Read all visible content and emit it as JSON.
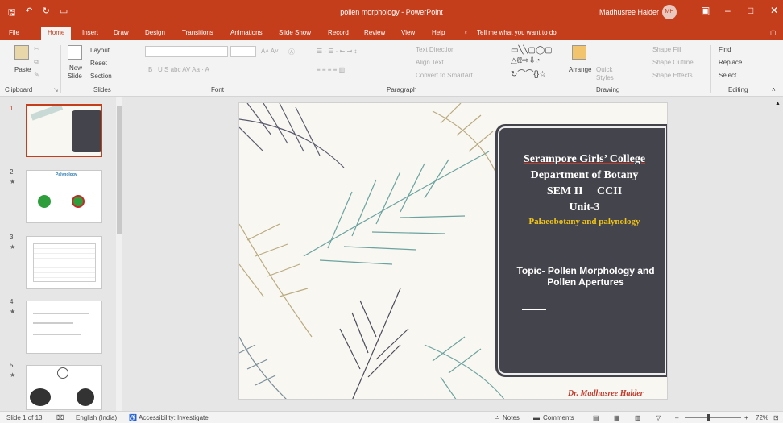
{
  "window": {
    "title": "pollen morphology  -  PowerPoint",
    "user": "Madhusree Halder",
    "avatar_initials": "MH",
    "search_hint": "Tell me what you want to do"
  },
  "tabs": [
    "File",
    "Home",
    "Insert",
    "Draw",
    "Design",
    "Transitions",
    "Animations",
    "Slide Show",
    "Record",
    "Review",
    "View",
    "Help"
  ],
  "ribbon": {
    "clipboard": {
      "paste": "Paste",
      "label": "Clipboard"
    },
    "slides": {
      "new_slide": "New",
      "new_slide2": "Slide",
      "layout": "Layout",
      "reset": "Reset",
      "section": "Section",
      "label": "Slides"
    },
    "font": {
      "label": "Font"
    },
    "paragraph": {
      "text_direction": "Text Direction",
      "align_text": "Align Text",
      "smartart": "Convert to SmartArt",
      "label": "Paragraph"
    },
    "drawing": {
      "arrange": "Arrange",
      "quick": "Quick",
      "styles": "Styles",
      "fill": "Shape Fill",
      "outline": "Shape Outline",
      "effects": "Shape Effects",
      "label": "Drawing"
    },
    "editing": {
      "find": "Find",
      "replace": "Replace",
      "select": "Select",
      "label": "Editing"
    }
  },
  "slides": [
    {
      "num": "1"
    },
    {
      "num": "2"
    },
    {
      "num": "3"
    },
    {
      "num": "4"
    },
    {
      "num": "5"
    }
  ],
  "slide": {
    "line1": "Serampore Girls’ College",
    "line2": "Department of Botany",
    "line3": "SEM II     CCII",
    "line4": "Unit-3",
    "line5": "Palaeobotany and palynology",
    "topic": "Topic- Pollen Morphology and Pollen Apertures",
    "signature": "Dr. Madhusree Halder"
  },
  "thumb2_title": "Palynology",
  "status": {
    "slide": "Slide 1 of 13",
    "lang": "English (India)",
    "access": "Accessibility: Investigate",
    "notes": "Notes",
    "comments": "Comments",
    "zoom": "72%"
  },
  "colors": {
    "accent": "#c43e1c",
    "panel": "#44444c",
    "heading_yellow": "#f0c419"
  }
}
